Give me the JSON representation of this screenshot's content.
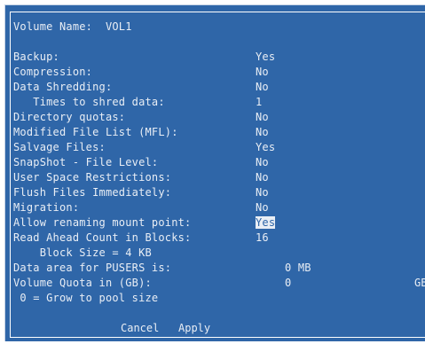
{
  "volume_name_line": "Volume Name:  VOL1",
  "rows": [
    {
      "label": "Backup:",
      "value": "Yes"
    },
    {
      "label": "Compression:",
      "value": "No"
    },
    {
      "label": "Data Shredding:",
      "value": "No"
    },
    {
      "label": "   Times to shred data:",
      "value": "1"
    },
    {
      "label": "Directory quotas:",
      "value": "No"
    },
    {
      "label": "Modified File List (MFL):",
      "value": "No"
    },
    {
      "label": "Salvage Files:",
      "value": "Yes"
    },
    {
      "label": "SnapShot - File Level:",
      "value": "No"
    },
    {
      "label": "User Space Restrictions:",
      "value": "No"
    },
    {
      "label": "Flush Files Immediately:",
      "value": "No"
    },
    {
      "label": "Migration:",
      "value": "No"
    },
    {
      "label": "Allow renaming mount point:",
      "value": "Yes"
    },
    {
      "label": "Read Ahead Count in Blocks:",
      "value": "16"
    }
  ],
  "block_size_note": "    Block Size = 4 KB",
  "pusers": {
    "label": "Data area for PUSERS is:",
    "value": "0 MB"
  },
  "volume_quota": {
    "label": "Volume Quota in (GB):",
    "value": "0",
    "unit": "GB"
  },
  "grow_note": " 0 = Grow to pool size",
  "buttons": {
    "cancel": "Cancel",
    "apply": "Apply"
  },
  "colors": {
    "background": "#2f66a8",
    "text": "#e9eef5"
  }
}
